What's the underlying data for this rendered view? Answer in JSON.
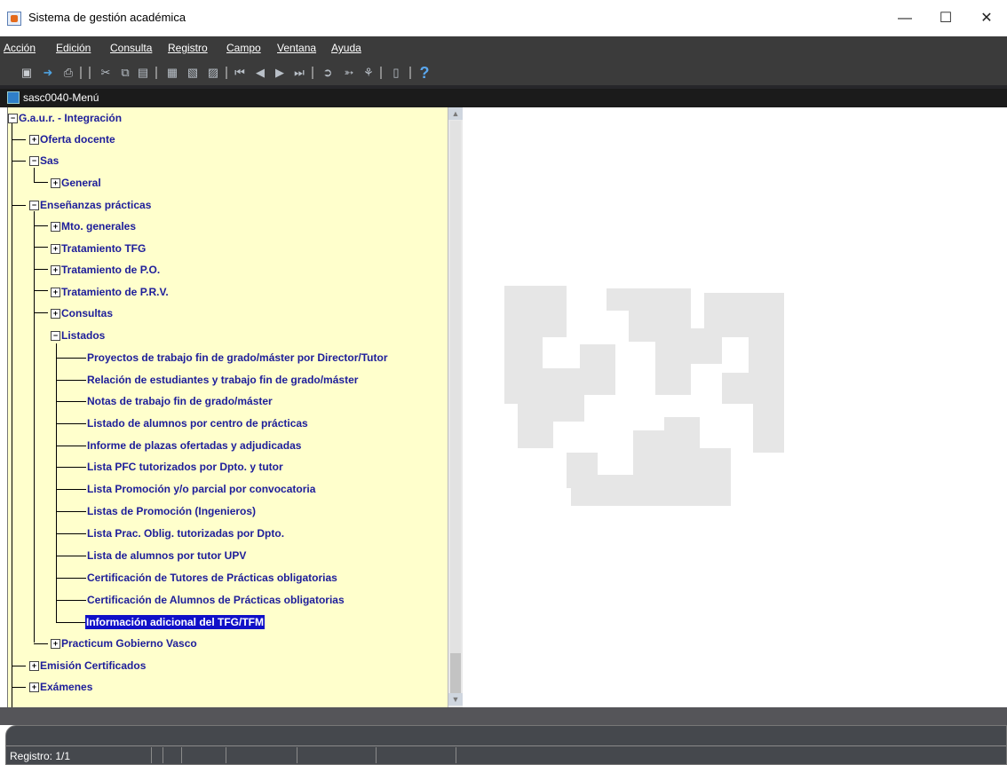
{
  "window": {
    "title": "Sistema de gestión académica"
  },
  "menu": [
    "Acción",
    "Edición",
    "Consulta",
    "Registro",
    "Campo",
    "Ventana",
    "Ayuda"
  ],
  "subwindow": {
    "title": "sasc0040-Menú"
  },
  "tree": {
    "root": "G.a.u.r. - Integración",
    "nodes": [
      "Oferta docente",
      "Sas",
      "General",
      "Enseñanzas prácticas",
      "Mto. generales",
      "Tratamiento TFG",
      "Tratamiento de P.O.",
      "Tratamiento de P.R.V.",
      "Consultas",
      "Listados",
      "Proyectos de trabajo fin de grado/máster por Director/Tutor",
      "Relación de estudiantes y trabajo fin de grado/máster",
      "Notas de trabajo fin de grado/máster",
      "Listado de alumnos por centro de prácticas",
      "Informe de plazas ofertadas y adjudicadas",
      "Lista PFC tutorizados por Dpto. y tutor",
      "Lista Promoción y/o parcial por convocatoria",
      "Listas de Promoción (Ingenieros)",
      "Lista Prac. Oblig. tutorizadas por Dpto.",
      "Lista de alumnos por tutor UPV",
      "Certificación de Tutores de Prácticas obligatorias",
      "Certificación de Alumnos de Prácticas obligatorias",
      "Información adicional del TFG/TFM",
      "Practicum Gobierno Vasco",
      "Emisión Certificados",
      "Exámenes"
    ]
  },
  "toolbar_icons": [
    "save-icon",
    "exit-icon",
    "print-icon",
    "cut-icon",
    "copy-icon",
    "paste-icon",
    "clear-field-icon",
    "insert-record-icon",
    "duplicate-record-icon",
    "first-record-icon",
    "previous-record-icon",
    "next-record-icon",
    "last-record-icon",
    "enter-query-icon",
    "execute-query-icon",
    "lock-record-icon",
    "delete-record-icon",
    "help-icon"
  ],
  "statusbar": {
    "record": "Registro: 1/1"
  },
  "colors": {
    "tree_bg": "#ffffcc",
    "node_text": "#1d1d9a",
    "selection": "#1010c8",
    "menubar": "#3b3b3b"
  }
}
